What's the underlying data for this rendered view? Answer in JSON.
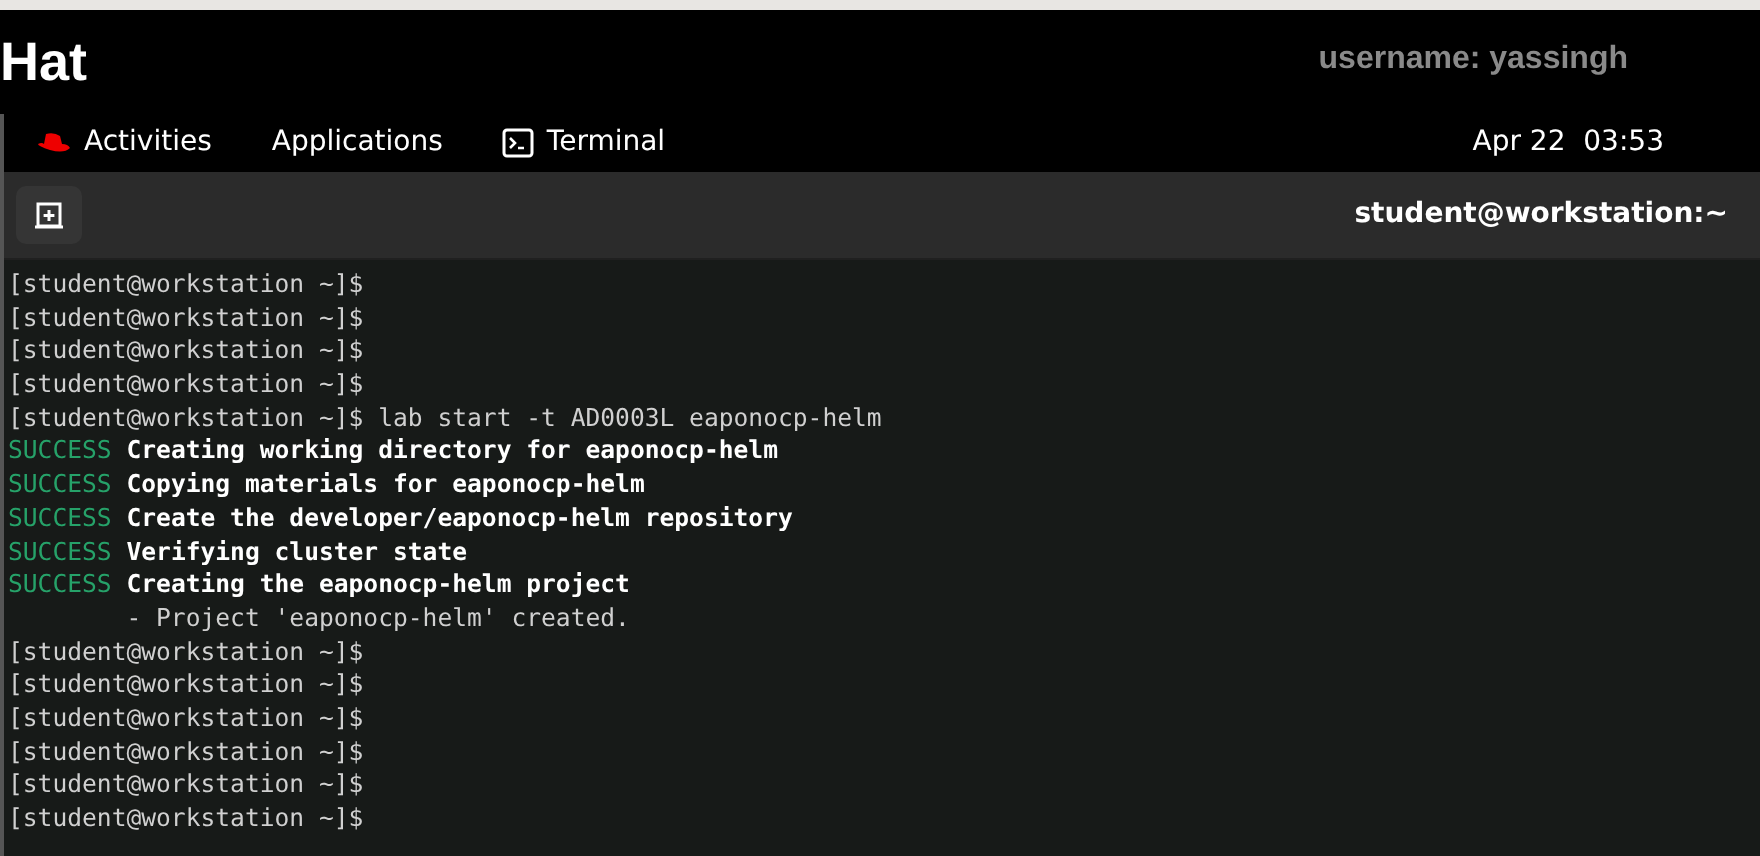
{
  "banner": {
    "brand": "Hat",
    "username": "username: yassingh"
  },
  "top_bar": {
    "items": [
      {
        "kind": "activities",
        "label": "Activities"
      },
      {
        "kind": "menu",
        "label": "Applications"
      },
      {
        "kind": "app",
        "label": "Terminal"
      }
    ],
    "clock": "Apr 22  03:53"
  },
  "terminal": {
    "title": "student@workstation:~",
    "lines": [
      {
        "kind": "prompt",
        "prompt": "[student@workstation ~]$"
      },
      {
        "kind": "prompt",
        "prompt": "[student@workstation ~]$"
      },
      {
        "kind": "prompt",
        "prompt": "[student@workstation ~]$"
      },
      {
        "kind": "prompt",
        "prompt": "[student@workstation ~]$"
      },
      {
        "kind": "prompt",
        "prompt": "[student@workstation ~]$",
        "command": "lab start -t AD0003L eaponocp-helm"
      },
      {
        "kind": "success",
        "status": "SUCCESS",
        "message": "Creating working directory for eaponocp-helm"
      },
      {
        "kind": "success",
        "status": "SUCCESS",
        "message": "Copying materials for eaponocp-helm"
      },
      {
        "kind": "success",
        "status": "SUCCESS",
        "message": "Create the developer/eaponocp-helm repository"
      },
      {
        "kind": "success",
        "status": "SUCCESS",
        "message": "Verifying cluster state"
      },
      {
        "kind": "success",
        "status": "SUCCESS",
        "message": "Creating the eaponocp-helm project"
      },
      {
        "kind": "output",
        "text": "        - Project 'eaponocp-helm' created."
      },
      {
        "kind": "prompt",
        "prompt": "[student@workstation ~]$"
      },
      {
        "kind": "prompt",
        "prompt": "[student@workstation ~]$"
      },
      {
        "kind": "prompt",
        "prompt": "[student@workstation ~]$"
      },
      {
        "kind": "prompt",
        "prompt": "[student@workstation ~]$"
      },
      {
        "kind": "prompt",
        "prompt": "[student@workstation ~]$"
      },
      {
        "kind": "prompt",
        "prompt": "[student@workstation ~]$"
      }
    ]
  }
}
